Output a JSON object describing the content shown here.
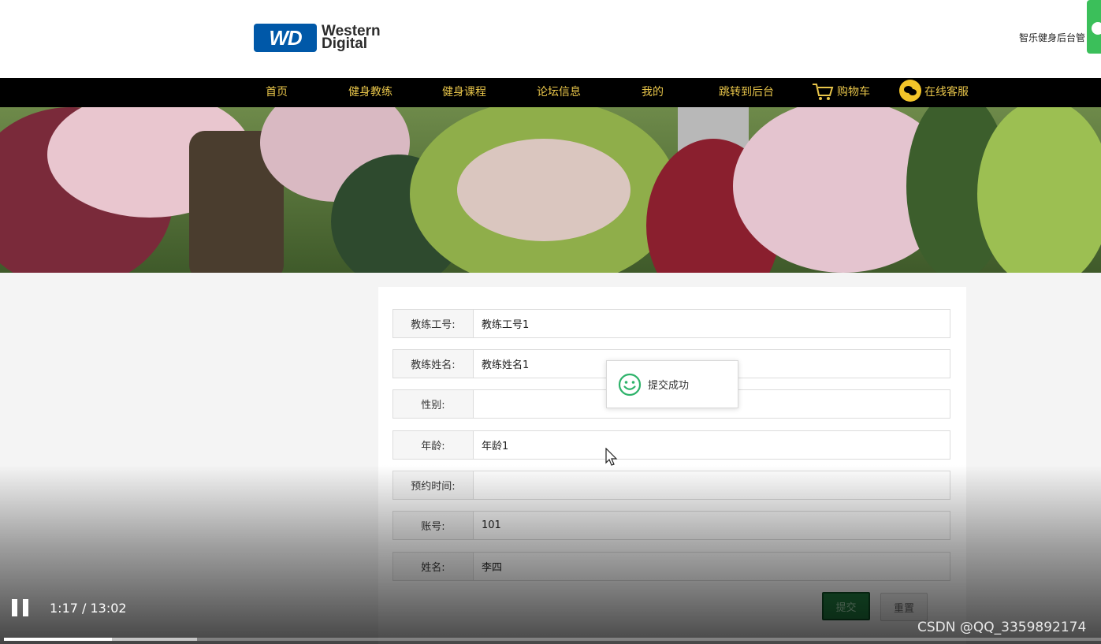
{
  "header": {
    "logo_mark": "WD",
    "logo_line1": "Western",
    "logo_line2": "Digital",
    "site_name": "智乐健身后台管"
  },
  "nav": {
    "items": [
      {
        "label": "首页"
      },
      {
        "label": "健身教练"
      },
      {
        "label": "健身课程"
      },
      {
        "label": "论坛信息"
      },
      {
        "label": "我的"
      },
      {
        "label": "跳转到后台"
      },
      {
        "label": "购物车"
      },
      {
        "label": "在线客服"
      }
    ]
  },
  "form": {
    "fields": [
      {
        "label": "教练工号:",
        "value": "教练工号1"
      },
      {
        "label": "教练姓名:",
        "value": "教练姓名1"
      },
      {
        "label": "性别:",
        "value": ""
      },
      {
        "label": "年龄:",
        "value": "年龄1"
      },
      {
        "label": "预约时间:",
        "value": ""
      },
      {
        "label": "账号:",
        "value": "101"
      },
      {
        "label": "姓名:",
        "value": "李四"
      }
    ],
    "submit_label": "提交",
    "reset_label": "重置"
  },
  "toast": {
    "message": "提交成功"
  },
  "player": {
    "time": "1:17 / 13:02",
    "played_fraction": 0.0985,
    "buffered_fraction": 0.176
  },
  "watermark": "CSDN @QQ_3359892174",
  "colors": {
    "nav_bg": "#000000",
    "nav_text": "#e8c54a",
    "submit_bg": "#1f7a3e",
    "toast_icon": "#2fb36b",
    "logo_blue": "#0058a8"
  }
}
